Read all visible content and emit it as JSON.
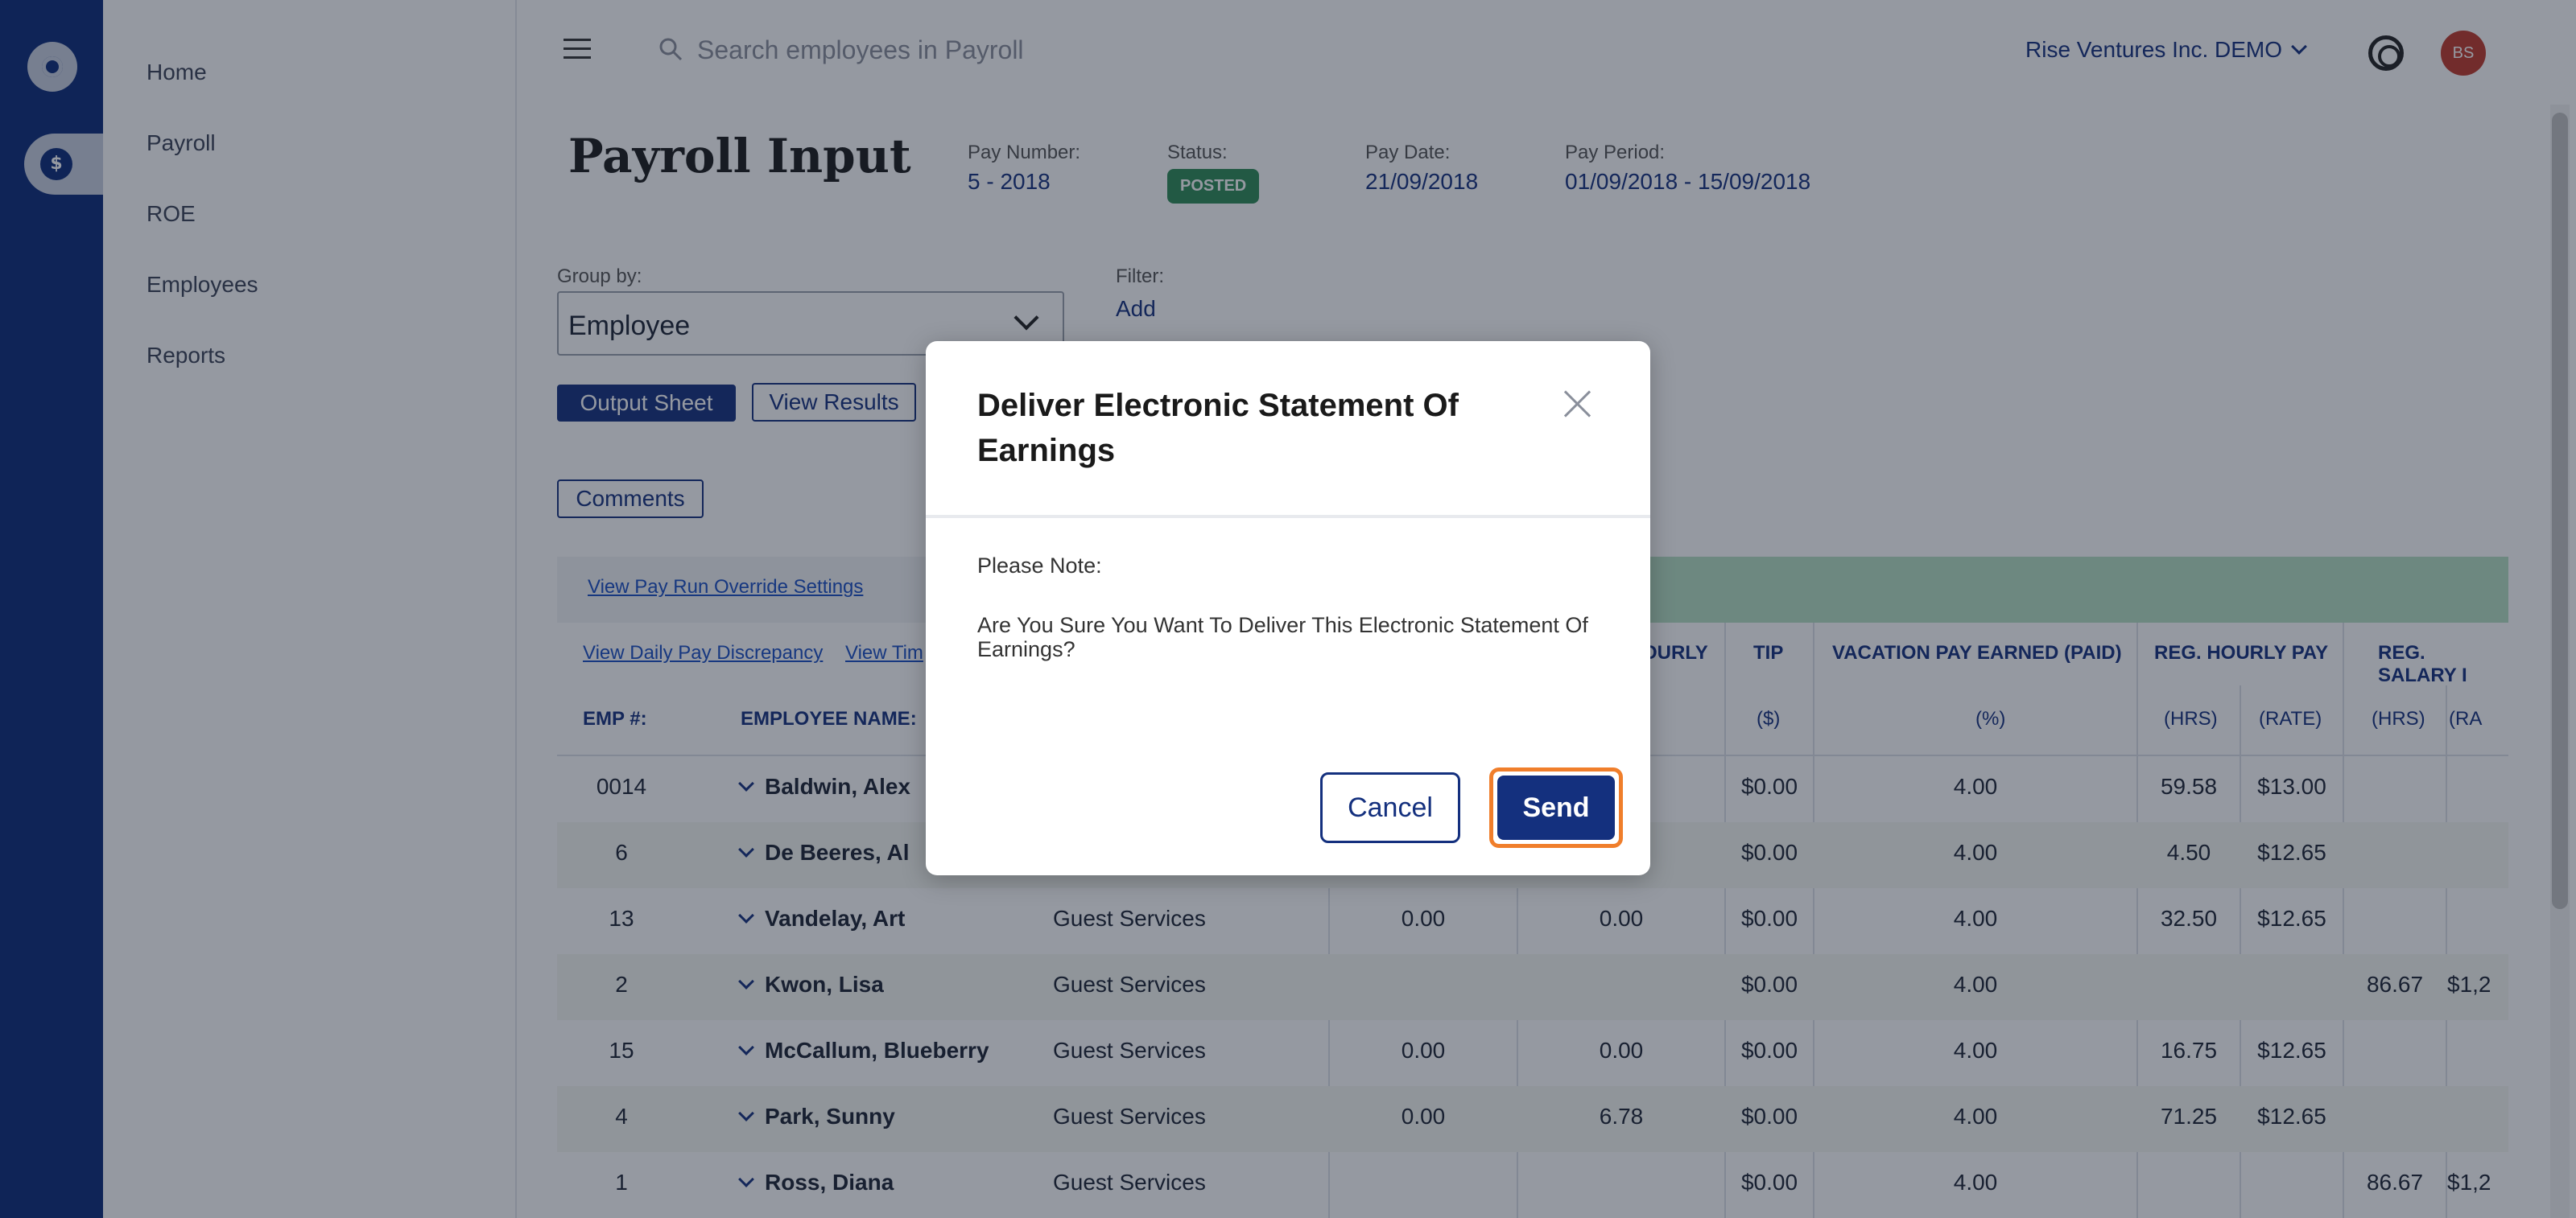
{
  "nav": {
    "items": [
      "Home",
      "Payroll",
      "ROE",
      "Employees",
      "Reports"
    ]
  },
  "top": {
    "search_placeholder": "Search employees in Payroll",
    "company": "Rise Ventures Inc. DEMO",
    "avatar": "BS"
  },
  "page": {
    "title": "Payroll Input",
    "pay_number_label": "Pay Number:",
    "pay_number": "5 - 2018",
    "status_label": "Status:",
    "status": "POSTED",
    "pay_date_label": "Pay Date:",
    "pay_date": "21/09/2018",
    "pay_period_label": "Pay Period:",
    "pay_period": "01/09/2018 - 15/09/2018",
    "group_by_label": "Group by:",
    "group_by": "Employee",
    "filter_label": "Filter:",
    "filter_add": "Add",
    "output_sheet": "Output Sheet",
    "view_results": "View Results",
    "comments": "Comments",
    "link_override": "View Pay Run Override Settings",
    "link_daily": "View Daily Pay Discrepancy",
    "link_time": "View Tim"
  },
  "table": {
    "headers": {
      "emp": "EMP #:",
      "name": "EMPLOYEE NAME:",
      "hourly": "OURLY",
      "tip": "TIP",
      "vac": "VACATION PAY EARNED (PAID)",
      "reg_hourly": "REG. HOURLY PAY",
      "reg_salary": "REG. SALARY I"
    },
    "subheaders": {
      "hourly_unit": ")",
      "tip_unit": "($)",
      "vac_unit": "(%)",
      "hrs": "(HRS)",
      "rate": "(RATE)",
      "hrs2": "(HRS)",
      "ra": "(RA"
    },
    "rows": [
      {
        "emp": "0014",
        "name": "Baldwin, Alex",
        "dept": "",
        "c1": "",
        "c2": "",
        "tip": "$0.00",
        "vac": "4.00",
        "hrs": "59.58",
        "rate": "$13.00",
        "shrs": "",
        "srate": ""
      },
      {
        "emp": "6",
        "name": "De Beeres, Al",
        "dept": "",
        "c1": "",
        "c2": "",
        "tip": "$0.00",
        "vac": "4.00",
        "hrs": "4.50",
        "rate": "$12.65",
        "shrs": "",
        "srate": ""
      },
      {
        "emp": "13",
        "name": "Vandelay, Art",
        "dept": "Guest Services",
        "c1": "0.00",
        "c2": "0.00",
        "tip": "$0.00",
        "vac": "4.00",
        "hrs": "32.50",
        "rate": "$12.65",
        "shrs": "",
        "srate": ""
      },
      {
        "emp": "2",
        "name": "Kwon, Lisa",
        "dept": "Guest Services",
        "c1": "",
        "c2": "",
        "tip": "$0.00",
        "vac": "4.00",
        "hrs": "",
        "rate": "",
        "shrs": "86.67",
        "srate": "$1,2"
      },
      {
        "emp": "15",
        "name": "McCallum, Blueberry",
        "dept": "Guest Services",
        "c1": "0.00",
        "c2": "0.00",
        "tip": "$0.00",
        "vac": "4.00",
        "hrs": "16.75",
        "rate": "$12.65",
        "shrs": "",
        "srate": ""
      },
      {
        "emp": "4",
        "name": "Park, Sunny",
        "dept": "Guest Services",
        "c1": "0.00",
        "c2": "6.78",
        "tip": "$0.00",
        "vac": "4.00",
        "hrs": "71.25",
        "rate": "$12.65",
        "shrs": "",
        "srate": ""
      },
      {
        "emp": "1",
        "name": "Ross, Diana",
        "dept": "Guest Services",
        "c1": "",
        "c2": "",
        "tip": "$0.00",
        "vac": "4.00",
        "hrs": "",
        "rate": "",
        "shrs": "86.67",
        "srate": "$1,2"
      }
    ]
  },
  "modal": {
    "title": "Deliver Electronic Statement Of Earnings",
    "note": "Please Note:",
    "message": "Are You Sure You Want To Deliver This Electronic Statement Of Earnings?",
    "cancel": "Cancel",
    "send": "Send"
  },
  "colors": {
    "brand": "#14307e",
    "rail": "#0b2a78",
    "posted": "#2e8b57",
    "focus_ring": "#f07e2b"
  }
}
